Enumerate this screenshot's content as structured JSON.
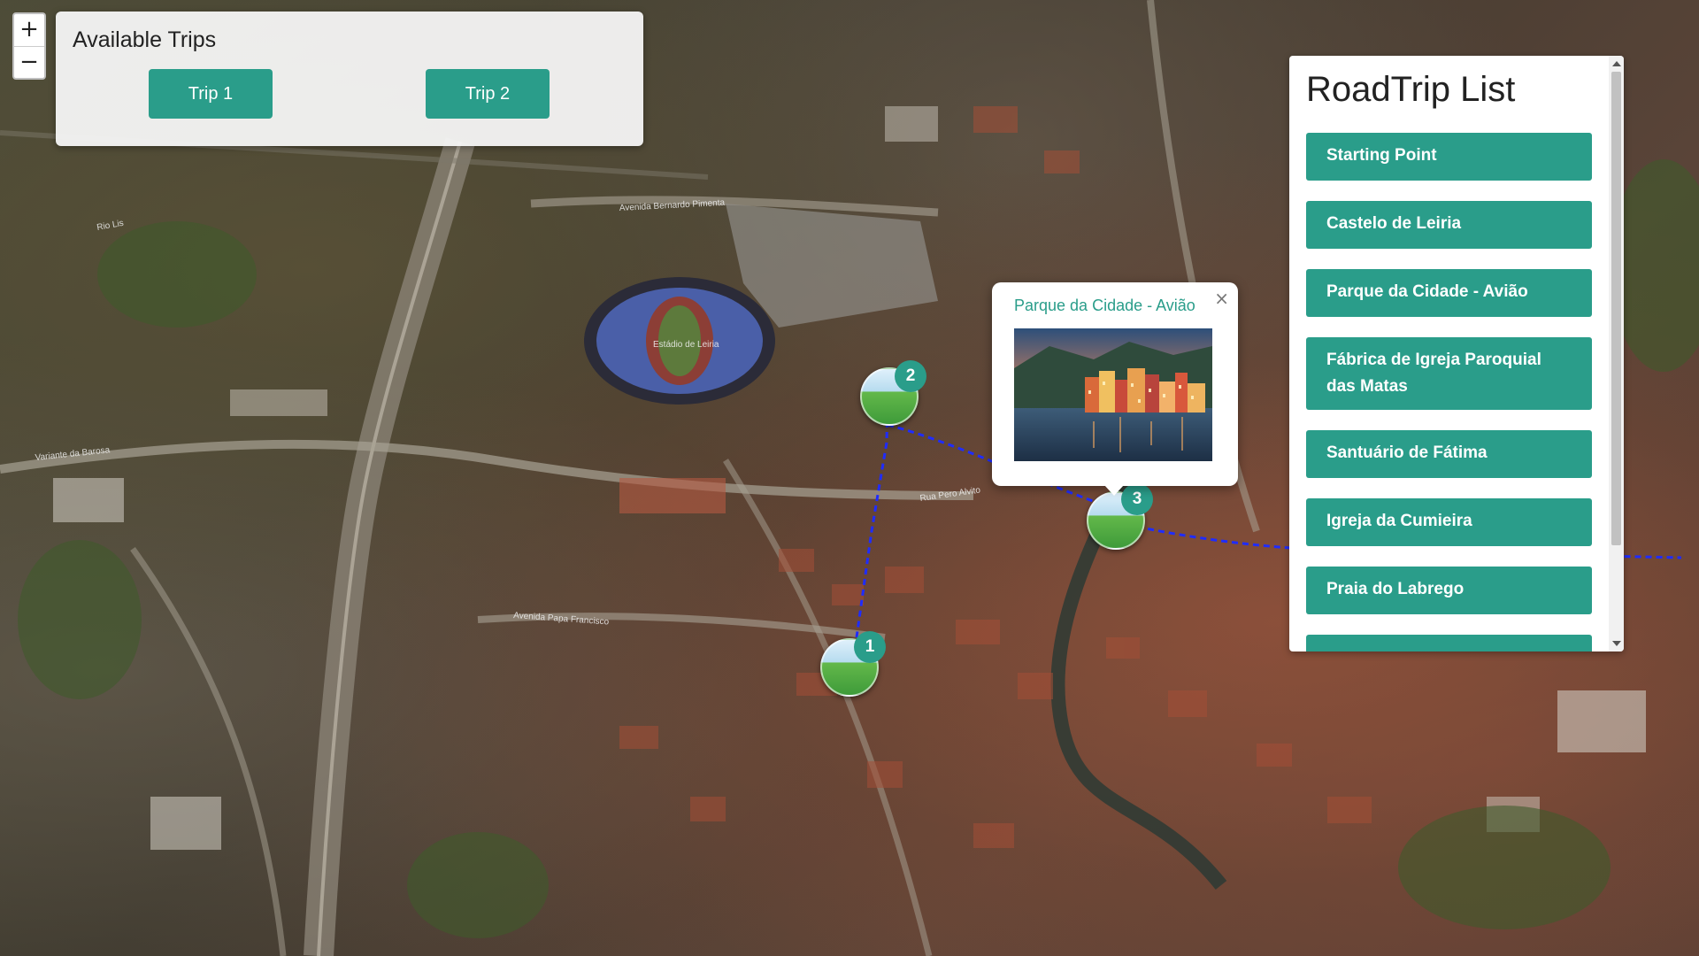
{
  "zoom": {
    "in_label": "+",
    "out_label": "−"
  },
  "trips_panel": {
    "title": "Available Trips",
    "buttons": [
      "Trip 1",
      "Trip 2"
    ]
  },
  "road_trip_list": {
    "title": "RoadTrip List",
    "items": [
      "Starting Point",
      "Castelo de Leiria",
      "Parque da Cidade - Avião",
      "Fábrica de Igreja Paroquial das Matas",
      "Santuário de Fátima",
      "Igreja da Cumieira",
      "Praia do Labrego",
      ""
    ]
  },
  "popup": {
    "title": "Parque da Cidade - Avião",
    "close_label": "×"
  },
  "markers": [
    {
      "number": "1"
    },
    {
      "number": "2"
    },
    {
      "number": "3"
    }
  ],
  "colors": {
    "accent": "#2a9d8a",
    "route": "#1f2cff"
  },
  "map_labels": [
    "Avenida Bernardo Pimenta",
    "Estádio de Leiria",
    "Avenida Papa Francisco",
    "Rua Pero Alvito",
    "Variante da Barosa",
    "Rio Lis"
  ]
}
